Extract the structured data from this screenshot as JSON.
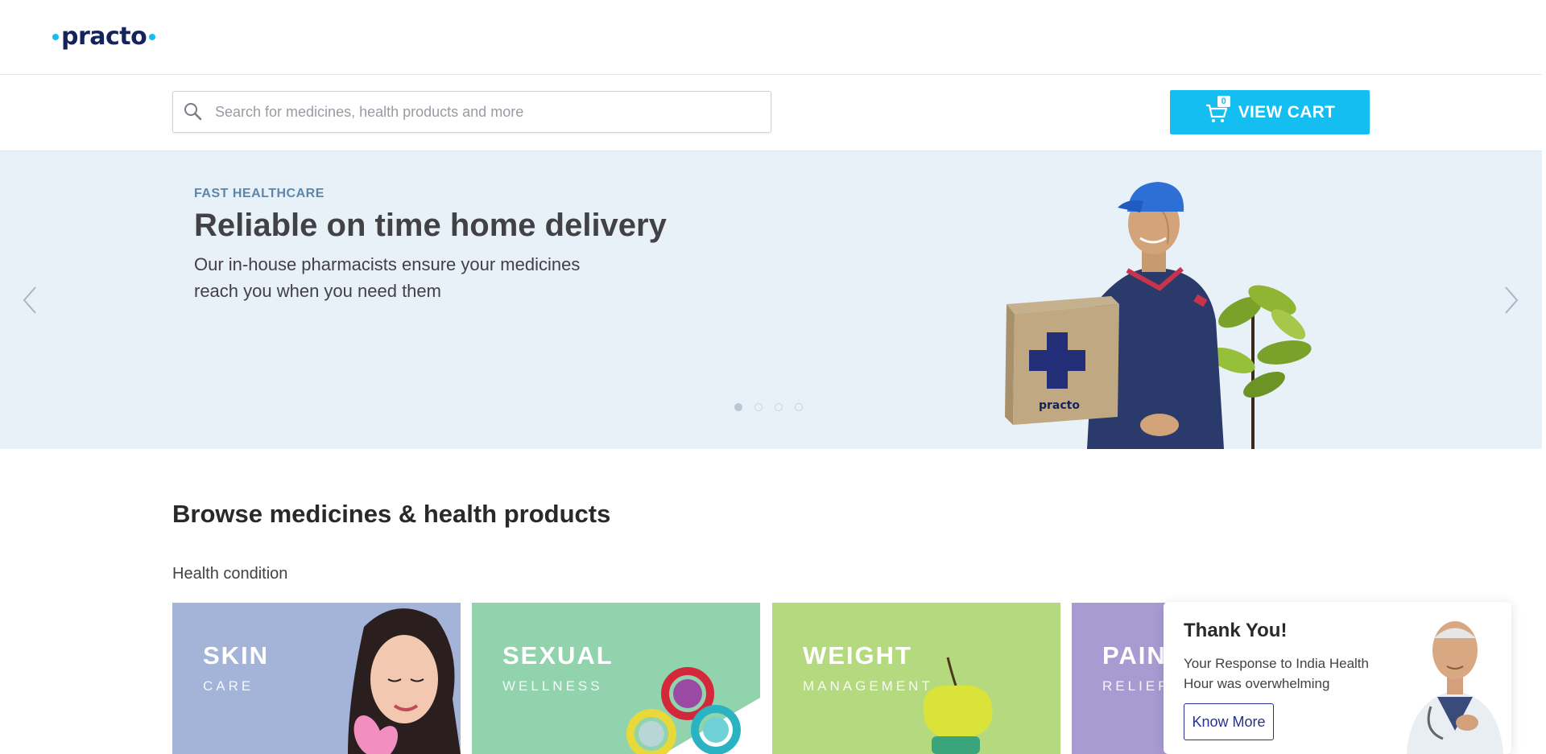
{
  "header": {
    "logo": "practo"
  },
  "search": {
    "placeholder": "Search for medicines, health products and more",
    "value": ""
  },
  "cart": {
    "count": "0",
    "label": "VIEW CART",
    "color": "#14bef0"
  },
  "hero": {
    "eyebrow": "FAST HEALTHCARE",
    "headline": "Reliable on time home delivery",
    "description": "Our in-house pharmacists ensure your medicines reach you when you need them",
    "box_label": "practo",
    "active_slide": 1,
    "slide_count": 4,
    "background": "#e8f0f8"
  },
  "browse": {
    "title": "Browse medicines & health products",
    "section": "Health condition",
    "categories": [
      {
        "title": "SKIN",
        "subtitle": "CARE",
        "color": "#a3b4d8"
      },
      {
        "title": "SEXUAL",
        "subtitle": "WELLNESS",
        "color": "#90d3ac"
      },
      {
        "title": "WEIGHT",
        "subtitle": "MANAGEMENT",
        "color": "#b5d97f"
      },
      {
        "title": "PAIN",
        "subtitle": "RELIEF",
        "color": "#a89bd1"
      }
    ]
  },
  "popup": {
    "title": "Thank You!",
    "text": "Your Response to India Health Hour was overwhelming",
    "button": "Know More"
  },
  "icons": {
    "search": "search-icon",
    "cart": "cart-icon",
    "prev": "chevron-left-icon",
    "next": "chevron-right-icon"
  }
}
